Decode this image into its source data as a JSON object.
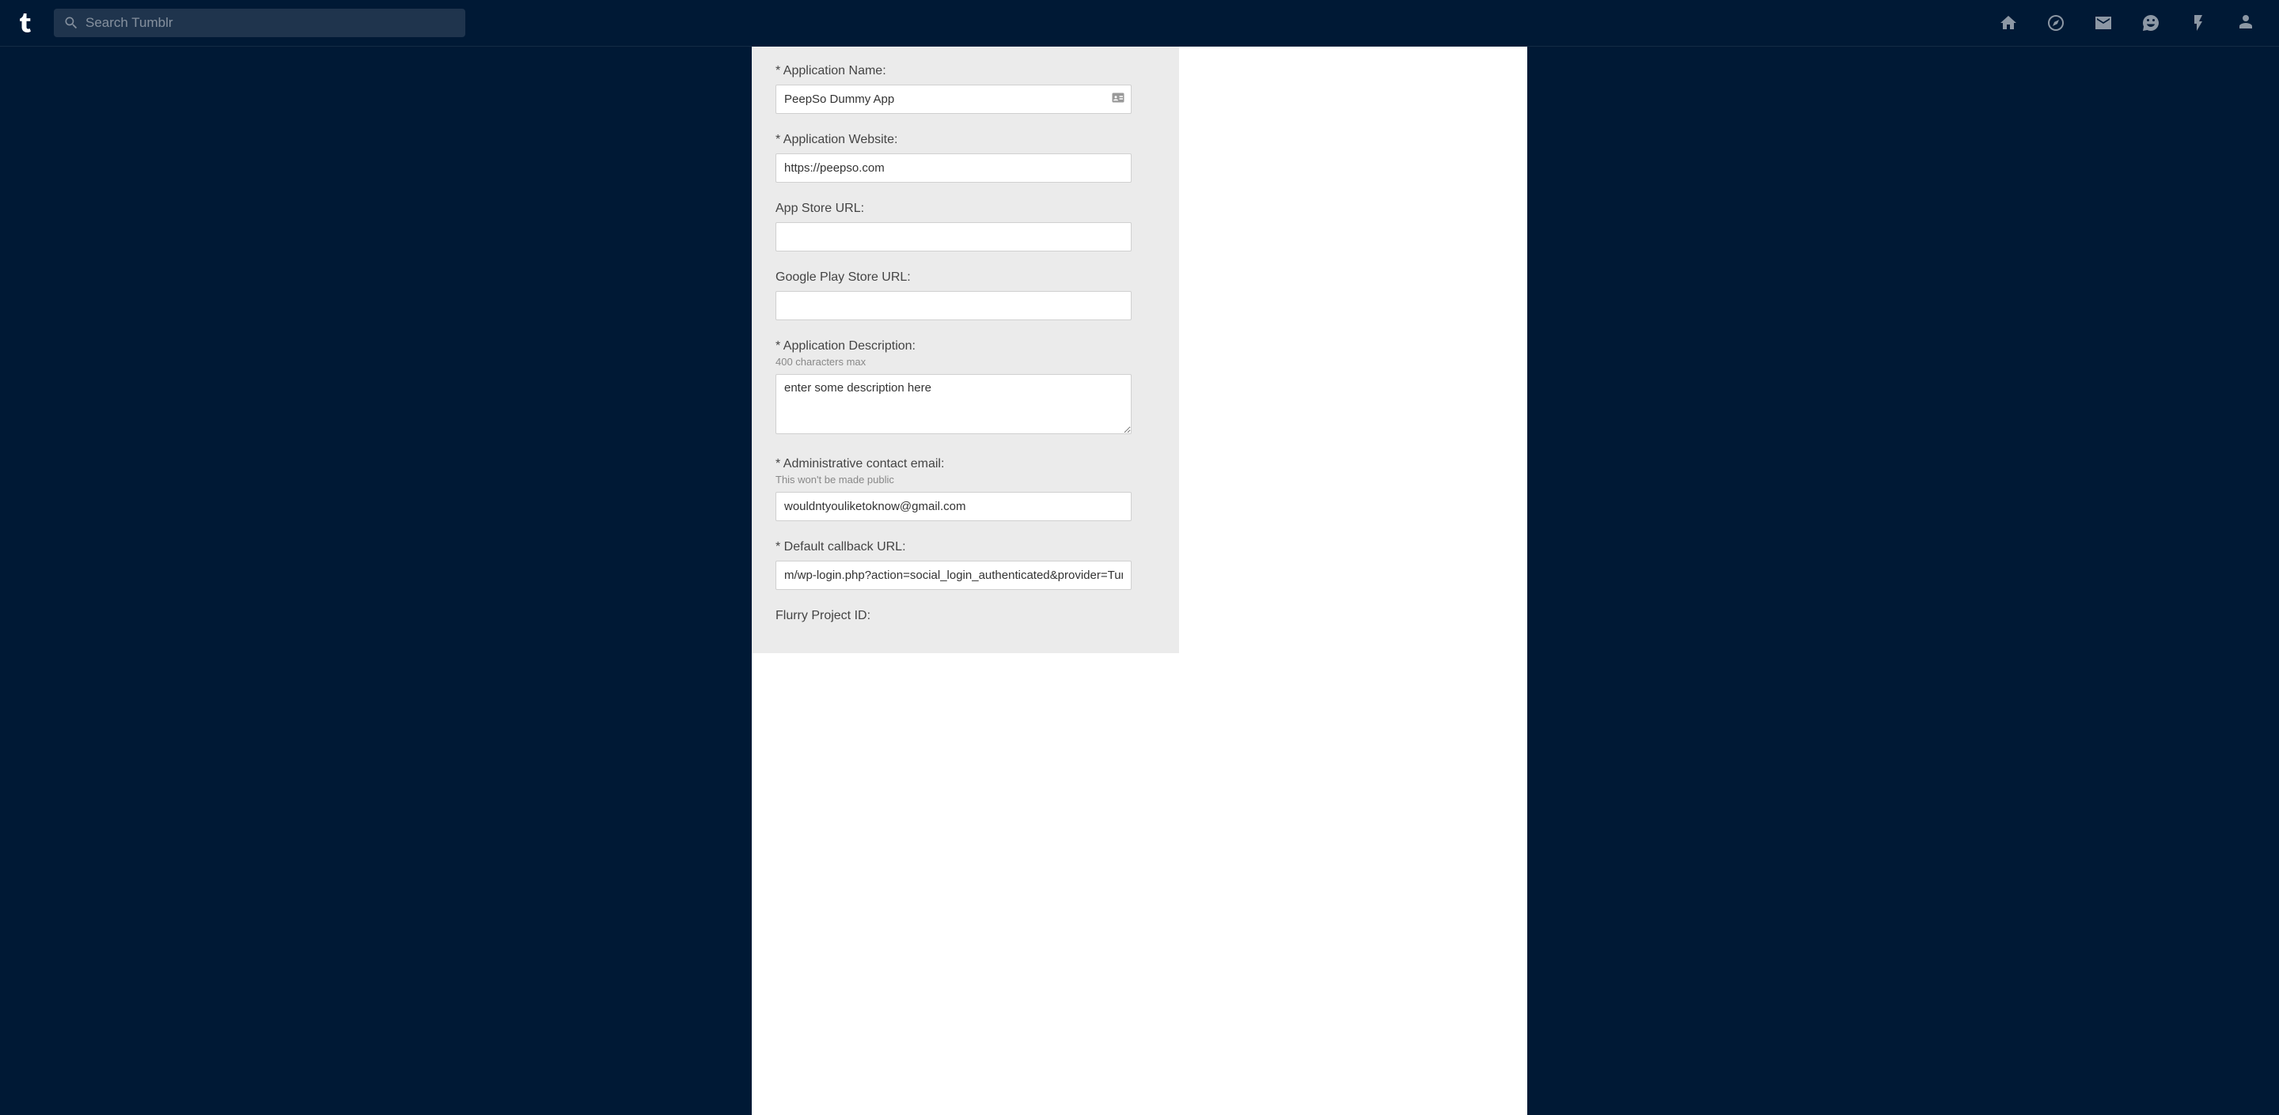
{
  "search": {
    "placeholder": "Search Tumblr"
  },
  "form": {
    "app_name": {
      "label": "* Application Name:",
      "value": "PeepSo Dummy App"
    },
    "app_website": {
      "label": "* Application Website:",
      "value": "https://peepso.com"
    },
    "app_store": {
      "label": "App Store URL:",
      "value": ""
    },
    "play_store": {
      "label": "Google Play Store URL:",
      "value": ""
    },
    "description": {
      "label": "* Application Description:",
      "hint": "400 characters max",
      "value": "enter some description here"
    },
    "admin_email": {
      "label": "* Administrative contact email:",
      "hint": "This won't be made public",
      "value": "wouldntyouliketoknow@gmail.com"
    },
    "callback": {
      "label": "* Default callback URL:",
      "value": "m/wp-login.php?action=social_login_authenticated&provider=Tumblr"
    },
    "flurry": {
      "label": "Flurry Project ID:"
    }
  }
}
